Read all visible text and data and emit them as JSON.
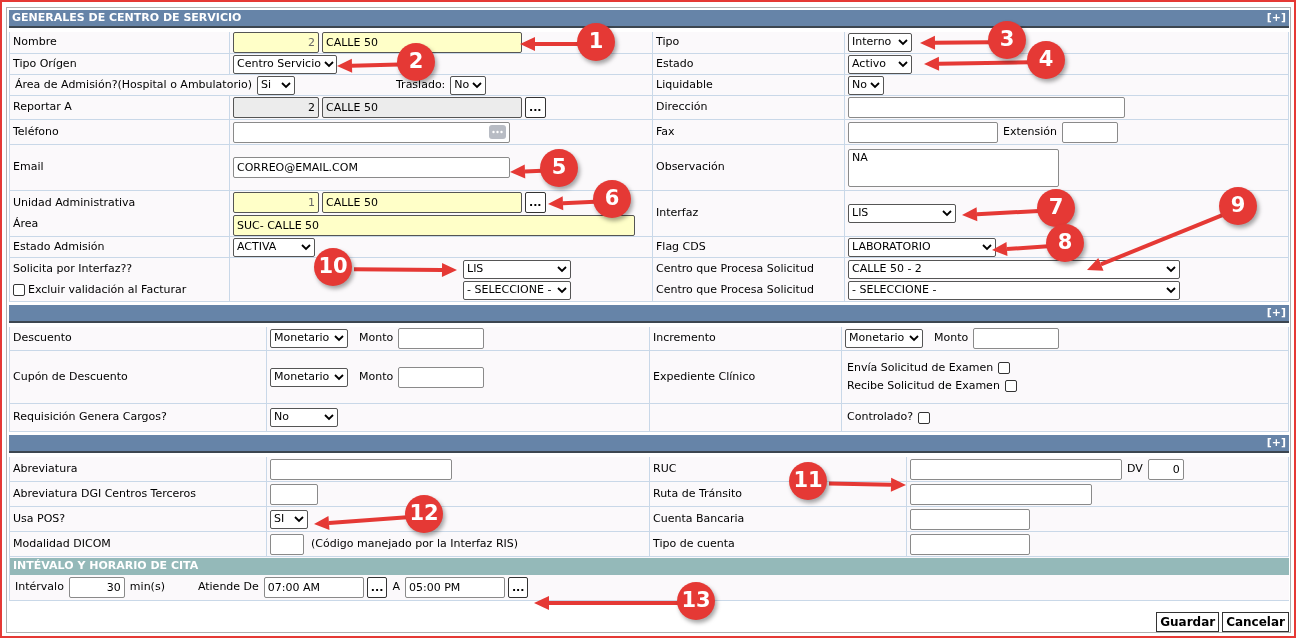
{
  "sections": [
    {
      "title": "GENERALES DE CENTRO DE SERVICIO",
      "toggle": "[+]",
      "rows": [
        {
          "left": {
            "labels": [
              {
                "kind": "text",
                "text": "Nombre"
              }
            ],
            "lines": [
              [
                {
                  "kind": "number_input",
                  "value": "2",
                  "highlighted": true
                },
                {
                  "kind": "text_input",
                  "value": "CALLE 50",
                  "highlighted": true
                }
              ]
            ]
          },
          "right": {
            "labels": [
              {
                "kind": "text",
                "text": "Tipo"
              }
            ],
            "lines": [
              [
                {
                  "kind": "select",
                  "value": "Interno"
                }
              ]
            ]
          }
        },
        {
          "left": {
            "labels": [
              {
                "kind": "text",
                "text": "Tipo Orígen"
              }
            ],
            "lines": [
              [
                {
                  "kind": "select",
                  "value": "Centro Servicio"
                }
              ]
            ]
          },
          "right": {
            "labels": [
              {
                "kind": "text",
                "text": "Estado"
              }
            ],
            "lines": [
              [
                {
                  "kind": "select",
                  "value": "Activo"
                }
              ]
            ]
          }
        },
        {
          "left": {
            "lines": [
              [
                {
                  "kind": "label",
                  "text": "Área de Admisión?(Hospital o Ambulatorio)"
                },
                {
                  "kind": "select",
                  "value": "Si"
                },
                {
                  "kind": "label",
                  "text": "Traslado:"
                },
                {
                  "kind": "select",
                  "value": "No"
                }
              ]
            ]
          },
          "right": {
            "labels": [
              {
                "kind": "text",
                "text": "Liquidable"
              }
            ],
            "lines": [
              [
                {
                  "kind": "select",
                  "value": "No"
                }
              ]
            ]
          }
        },
        {
          "left": {
            "labels": [
              {
                "kind": "text",
                "text": "Reportar A"
              }
            ],
            "lines": [
              [
                {
                  "kind": "number_input",
                  "value": "2",
                  "readonly": true
                },
                {
                  "kind": "text_input",
                  "value": "CALLE 50",
                  "readonly": true
                },
                {
                  "kind": "button",
                  "text": "..."
                }
              ]
            ]
          },
          "right": {
            "labels": [
              {
                "kind": "text",
                "text": "Dirección"
              }
            ],
            "lines": [
              [
                {
                  "kind": "text_input"
                }
              ]
            ]
          }
        },
        {
          "left": {
            "labels": [
              {
                "kind": "text",
                "text": "Teléfono"
              }
            ],
            "lines": [
              [
                {
                  "kind": "picker_input"
                }
              ]
            ]
          },
          "right": {
            "labels": [
              {
                "kind": "text",
                "text": "Fax"
              }
            ],
            "lines": [
              [
                {
                  "kind": "text_input"
                },
                {
                  "kind": "label",
                  "text": "Extensión"
                },
                {
                  "kind": "text_input"
                }
              ]
            ]
          }
        },
        {
          "left": {
            "labels": [
              {
                "kind": "text",
                "text": "Email"
              }
            ],
            "lines": [
              [
                {
                  "kind": "text_input",
                  "value": "CORREO@EMAIL.COM"
                }
              ]
            ]
          },
          "right": {
            "labels": [
              {
                "kind": "text",
                "text": "Observación"
              }
            ],
            "lines": [
              [
                {
                  "kind": "textarea",
                  "value": "NA"
                }
              ]
            ]
          }
        },
        {
          "left": {
            "labels": [
              {
                "kind": "text",
                "text": "Unidad Administrativa"
              },
              {
                "kind": "text",
                "text": "Área"
              }
            ],
            "lines": [
              [
                {
                  "kind": "number_input",
                  "value": "1",
                  "highlighted": true
                },
                {
                  "kind": "text_input",
                  "value": "CALLE 50",
                  "highlighted": true
                },
                {
                  "kind": "button",
                  "text": "..."
                }
              ],
              [
                {
                  "kind": "text_input",
                  "value": "SUC- CALLE 50",
                  "highlighted": true
                }
              ]
            ]
          },
          "right": {
            "labels": [
              {
                "kind": "text",
                "text": "Interfaz"
              }
            ],
            "lines": [
              [
                {
                  "kind": "select",
                  "value": "LIS"
                }
              ]
            ]
          }
        },
        {
          "left": {
            "labels": [
              {
                "kind": "text",
                "text": "Estado Admisión"
              }
            ],
            "lines": [
              [
                {
                  "kind": "select",
                  "value": "ACTIVA"
                }
              ]
            ]
          },
          "right": {
            "labels": [
              {
                "kind": "text",
                "text": "Flag CDS"
              }
            ],
            "lines": [
              [
                {
                  "kind": "select",
                  "value": "LABORATORIO"
                }
              ]
            ]
          }
        },
        {
          "left": {
            "labels": [
              {
                "kind": "text",
                "text": "Solicita por Interfaz??"
              },
              {
                "kind": "checkbox",
                "text": "Excluir validación al Facturar",
                "checked": false
              }
            ],
            "lines": [
              [
                {
                  "kind": "select",
                  "value": "LIS"
                }
              ],
              [
                {
                  "kind": "select",
                  "value": "- SELECCIONE -"
                }
              ]
            ]
          },
          "right": {
            "labels": [
              {
                "kind": "text",
                "text": "Centro que Procesa Solicitud"
              },
              {
                "kind": "text",
                "text": "Centro que Procesa Solicitud"
              }
            ],
            "lines": [
              [
                {
                  "kind": "select",
                  "value": "CALLE 50 - 2"
                }
              ],
              [
                {
                  "kind": "select",
                  "value": "- SELECCIONE -"
                }
              ]
            ]
          }
        }
      ]
    },
    {
      "toggle": "[+]",
      "rows": [
        {
          "left": {
            "labels": [
              {
                "kind": "text",
                "text": "Descuento"
              }
            ],
            "lines": [
              [
                {
                  "kind": "select",
                  "value": "Monetario"
                },
                {
                  "kind": "label",
                  "text": "Monto"
                },
                {
                  "kind": "text_input"
                }
              ]
            ]
          },
          "right": {
            "labels": [
              {
                "kind": "text",
                "text": "Incremento"
              }
            ],
            "lines": [
              [
                {
                  "kind": "select",
                  "value": "Monetario"
                },
                {
                  "kind": "label",
                  "text": "Monto"
                },
                {
                  "kind": "text_input"
                }
              ]
            ]
          }
        },
        {
          "left": {
            "labels": [
              {
                "kind": "text",
                "text": "Cupón de Descuento"
              }
            ],
            "lines": [
              [
                {
                  "kind": "select",
                  "value": "Monetario"
                },
                {
                  "kind": "label",
                  "text": "Monto"
                },
                {
                  "kind": "text_input"
                }
              ]
            ]
          },
          "right": {
            "labels": [
              {
                "kind": "text",
                "text": "Expediente Clínico"
              }
            ],
            "lines": [
              [
                {
                  "kind": "label",
                  "text": "Envía Solicitud de Examen"
                },
                {
                  "kind": "checkbox",
                  "checked": false
                }
              ],
              [
                {
                  "kind": "label",
                  "text": "Recibe Solicitud de Examen"
                },
                {
                  "kind": "checkbox",
                  "checked": false
                }
              ]
            ]
          }
        },
        {
          "left": {
            "labels": [
              {
                "kind": "text",
                "text": "Requisición Genera Cargos?"
              }
            ],
            "lines": [
              [
                {
                  "kind": "select",
                  "value": "No"
                }
              ]
            ]
          },
          "right": {
            "lines": [
              [
                {
                  "kind": "label",
                  "text": "Controlado?"
                },
                {
                  "kind": "checkbox",
                  "checked": false
                }
              ]
            ]
          }
        }
      ]
    },
    {
      "toggle": "[+]",
      "rows": [
        {
          "left": {
            "labels": [
              {
                "kind": "text",
                "text": "Abreviatura"
              }
            ],
            "lines": [
              [
                {
                  "kind": "text_input"
                }
              ]
            ]
          },
          "right": {
            "labels": [
              {
                "kind": "text",
                "text": "RUC"
              }
            ],
            "lines": [
              [
                {
                  "kind": "text_input"
                },
                {
                  "kind": "label",
                  "text": "DV"
                },
                {
                  "kind": "number_input",
                  "value": "0"
                }
              ]
            ]
          }
        },
        {
          "left": {
            "labels": [
              {
                "kind": "text",
                "text": "Abreviatura DGI Centros Terceros"
              }
            ],
            "lines": [
              [
                {
                  "kind": "text_input"
                }
              ]
            ]
          },
          "right": {
            "labels": [
              {
                "kind": "text",
                "text": "Ruta de Tránsito"
              }
            ],
            "lines": [
              [
                {
                  "kind": "text_input"
                }
              ]
            ]
          }
        },
        {
          "left": {
            "labels": [
              {
                "kind": "text",
                "text": "Usa POS?"
              }
            ],
            "lines": [
              [
                {
                  "kind": "select",
                  "value": "SI"
                }
              ]
            ]
          },
          "right": {
            "labels": [
              {
                "kind": "text",
                "text": "Cuenta Bancaria"
              }
            ],
            "lines": [
              [
                {
                  "kind": "text_input"
                }
              ]
            ]
          }
        },
        {
          "left": {
            "labels": [
              {
                "kind": "text",
                "text": "Modalidad DICOM"
              }
            ],
            "lines": [
              [
                {
                  "kind": "text_input"
                },
                {
                  "kind": "label",
                  "text": "(Código manejado por la Interfaz RIS)"
                }
              ]
            ]
          },
          "right": {
            "labels": [
              {
                "kind": "text",
                "text": "Tipo de cuenta"
              }
            ],
            "lines": [
              [
                {
                  "kind": "text_input"
                }
              ]
            ]
          }
        }
      ],
      "subsection": {
        "title": "INTÉVALO Y HORARIO DE CITA",
        "controls": [
          {
            "kind": "label",
            "text": "Intérvalo"
          },
          {
            "kind": "number_input",
            "value": "30"
          },
          {
            "kind": "label",
            "text": "min(s)"
          },
          {
            "kind": "label",
            "text": "Atiende De"
          },
          {
            "kind": "text_input",
            "value": "07:00 AM"
          },
          {
            "kind": "button",
            "text": "..."
          },
          {
            "kind": "label",
            "text": "A"
          },
          {
            "kind": "text_input",
            "value": "05:00 PM"
          },
          {
            "kind": "button",
            "text": "..."
          }
        ]
      }
    }
  ],
  "actions": [
    "Guardar",
    "Cancelar"
  ],
  "annotations": [
    {
      "label": "1"
    },
    {
      "label": "2"
    },
    {
      "label": "3"
    },
    {
      "label": "4"
    },
    {
      "label": "5"
    },
    {
      "label": "6"
    },
    {
      "label": "7"
    },
    {
      "label": "8"
    },
    {
      "label": "9"
    },
    {
      "label": "10"
    },
    {
      "label": "11"
    },
    {
      "label": "12"
    },
    {
      "label": "13"
    }
  ]
}
